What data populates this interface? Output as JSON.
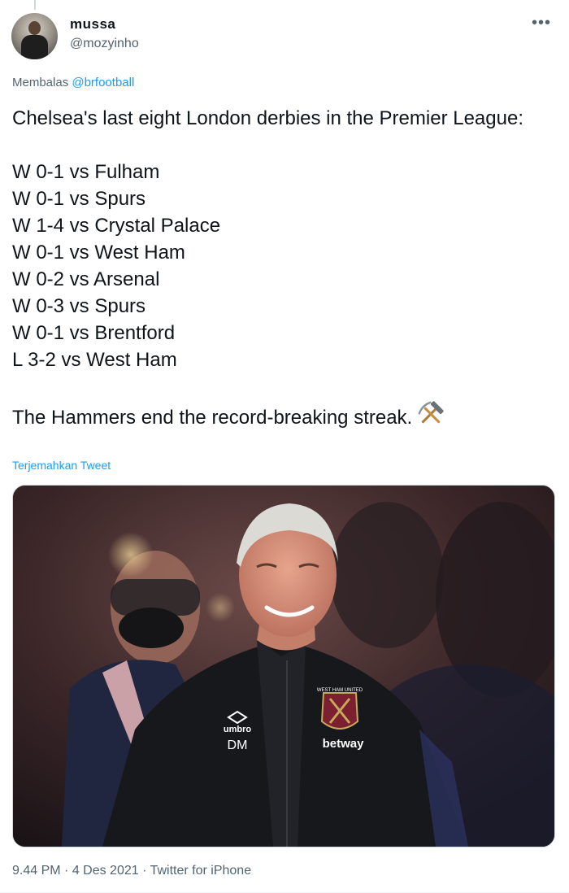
{
  "user": {
    "display_name": "mussa",
    "handle": "@mozyinho"
  },
  "menu": {
    "more_icon": "ellipsis-icon"
  },
  "reply": {
    "prefix": "Membalas ",
    "target": "@brfootball"
  },
  "tweet": {
    "text_lines": [
      "Chelsea's last eight London derbies in the Premier League:",
      "",
      "W 0-1 vs Fulham",
      "W 0-1 vs Spurs",
      "W 1-4 vs Crystal Palace",
      "W 0-1 vs West Ham",
      "W 0-2 vs Arsenal",
      "W 0-3 vs Spurs",
      "W 0-1 vs Brentford",
      "L 3-2 vs West Ham",
      ""
    ],
    "closing": "The Hammers end the record-breaking streak.",
    "emoji": "hammer-and-pick-icon",
    "translate_label": "Terjemahkan Tweet"
  },
  "photo": {
    "jacket_brand": "umbro",
    "initials": "DM",
    "sponsor": "betway",
    "badge_text": "WEST HAM UNITED"
  },
  "meta": {
    "time": "9.44 PM",
    "separator": " · ",
    "date": "4 Des 2021",
    "source": "Twitter for iPhone"
  },
  "colors": {
    "link": "#1d9bf0",
    "secondary_text": "#536471",
    "primary_text": "#0f1419"
  }
}
